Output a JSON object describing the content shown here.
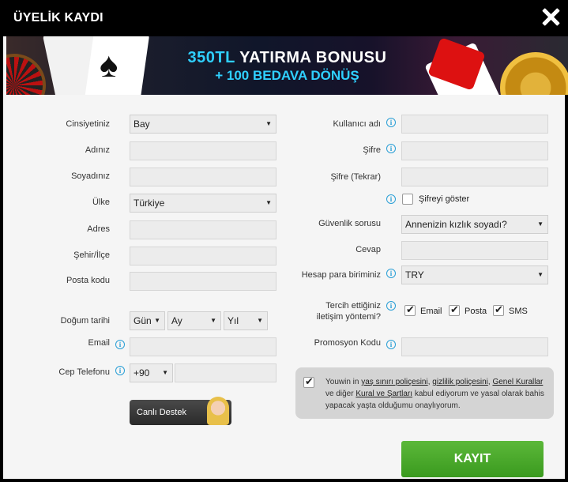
{
  "dialog": {
    "title": "ÜYELİK KAYDI"
  },
  "banner": {
    "line1_highlight": "350TL",
    "line1_rest": " YATIRMA BONUSU",
    "line2": "+ 100 BEDAVA DÖNÜŞ"
  },
  "left": {
    "gender_label": "Cinsiyetiniz",
    "gender_value": "Bay",
    "name_label": "Adınız",
    "surname_label": "Soyadınız",
    "country_label": "Ülke",
    "country_value": "Türkiye",
    "address_label": "Adres",
    "city_label": "Şehir/İlçe",
    "postcode_label": "Posta kodu",
    "birthdate_label": "Doğum tarihi",
    "day_value": "Gün",
    "month_value": "Ay",
    "year_value": "Yıl",
    "email_label": "Email",
    "phone_label": "Cep Telefonu",
    "phone_code_value": "+90",
    "livechat_label": "Canlı Destek"
  },
  "right": {
    "username_label": "Kullanıcı adı",
    "password_label": "Şifre",
    "password_repeat_label": "Şifre (Tekrar)",
    "show_password_label": "Şifreyi göster",
    "security_question_label": "Güvenlik sorusu",
    "security_question_value": "Annenizin kızlık soyadı?",
    "answer_label": "Cevap",
    "currency_label": "Hesap para biriminiz",
    "currency_value": "TRY",
    "contact_label_line1": "Tercih ettiğiniz",
    "contact_label_line2": "iletişim yöntemi?",
    "contact_email": "Email",
    "contact_post": "Posta",
    "contact_sms": "SMS",
    "promo_label": "Promosyon Kodu"
  },
  "agreement": {
    "brand": "Youwin",
    "t1": " in ",
    "link_age": "yaş sınırı poliçesini",
    "t2": ", ",
    "link_privacy": "gizlilik poliçesini",
    "t3": ", ",
    "link_general": "Genel Kurallar",
    "t4": " ve diğer ",
    "link_terms": "Kural ve Şartları",
    "t5": " kabul ediyorum ve yasal olarak bahis yapacak yaşta olduğumu onaylıyorum."
  },
  "submit_label": "KAYIT",
  "colors": {
    "accent_blue": "#2a9fd6",
    "submit_green": "#4caf2a",
    "titlebar": "#000000"
  },
  "icons": [
    "close-icon",
    "info-icon",
    "checkbox-check-icon",
    "dropdown-arrow-icon"
  ]
}
